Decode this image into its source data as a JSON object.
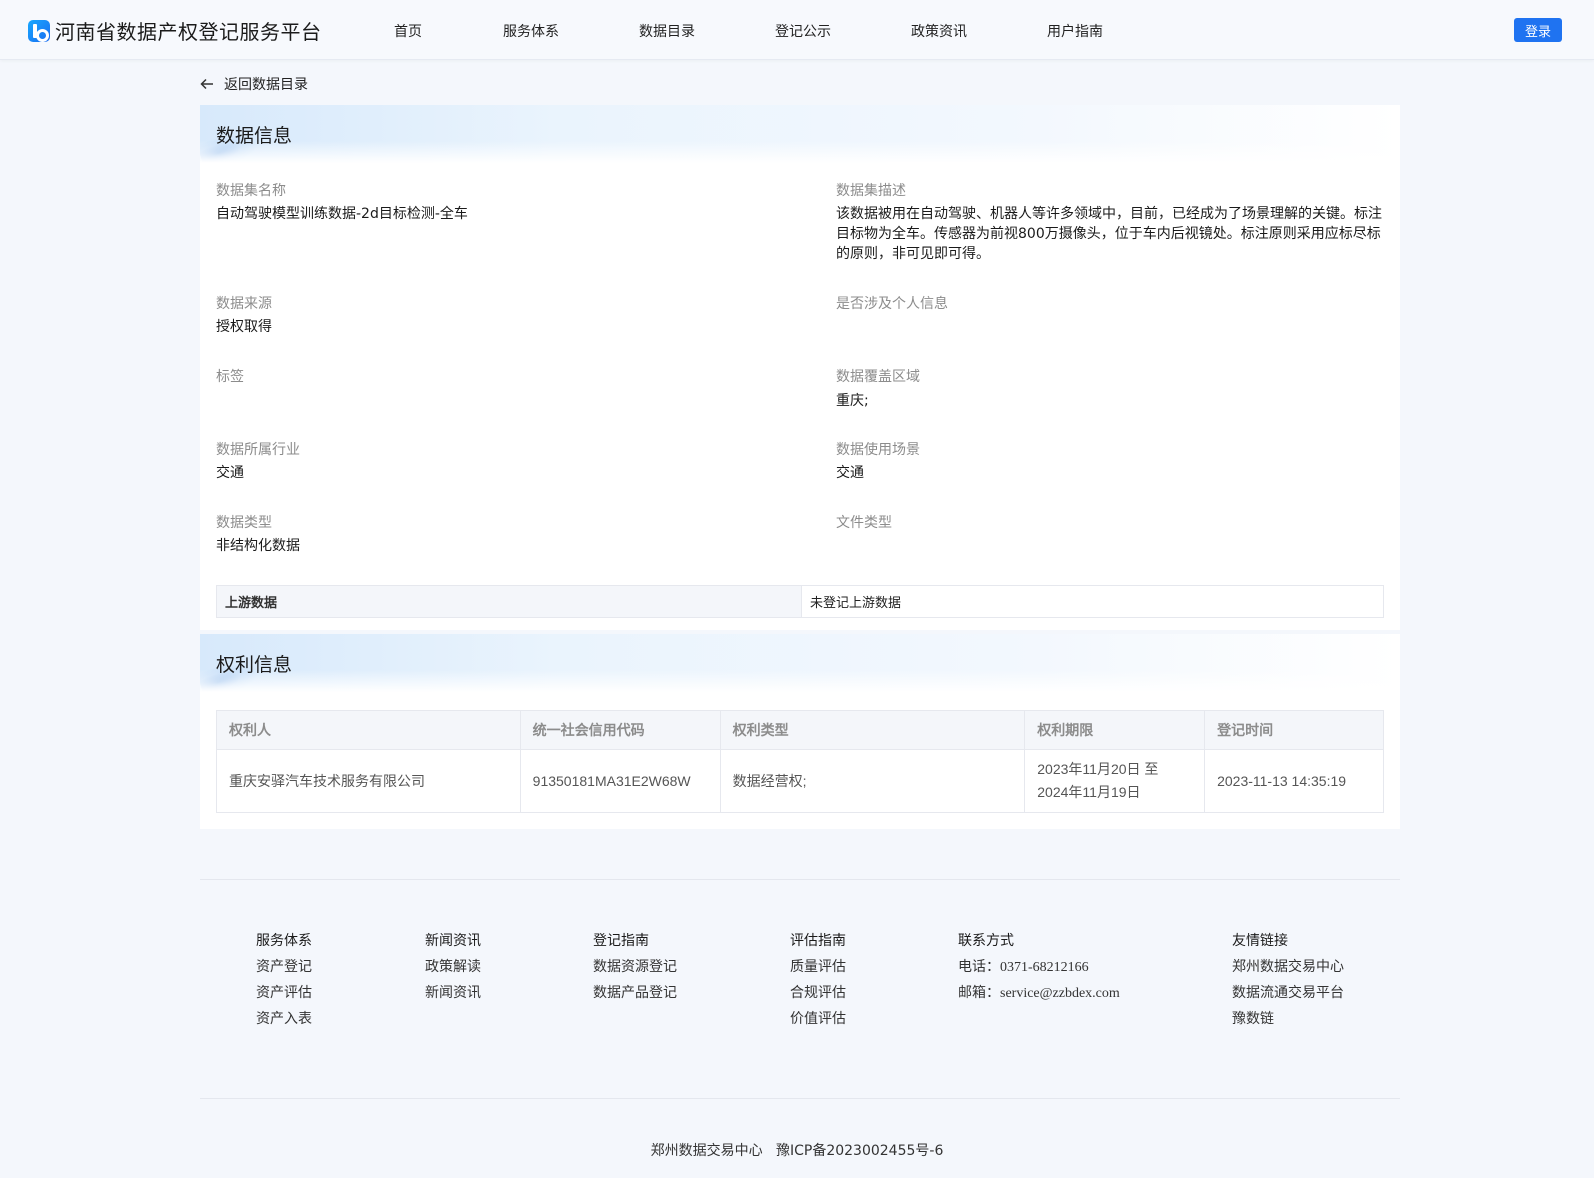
{
  "header": {
    "site_title": "河南省数据产权登记服务平台",
    "nav": [
      "首页",
      "服务体系",
      "数据目录",
      "登记公示",
      "政策资讯",
      "用户指南"
    ],
    "login_label": "登录"
  },
  "back_link": "返回数据目录",
  "data_info": {
    "section_title": "数据信息",
    "fields": {
      "dataset_name": {
        "label": "数据集名称",
        "value": "自动驾驶模型训练数据-2d目标检测-全车"
      },
      "dataset_desc": {
        "label": "数据集描述",
        "value": "该数据被用在自动驾驶、机器人等许多领域中，目前，已经成为了场景理解的关键。标注目标物为全车。传感器为前视800万摄像头，位于车内后视镜处。标注原则采用应标尽标的原则，非可见即可得。"
      },
      "source": {
        "label": "数据来源",
        "value": "授权取得"
      },
      "personal_info": {
        "label": "是否涉及个人信息",
        "value": ""
      },
      "tags": {
        "label": "标签",
        "value": ""
      },
      "coverage": {
        "label": "数据覆盖区域",
        "value": "重庆;"
      },
      "industry": {
        "label": "数据所属行业",
        "value": "交通"
      },
      "scenario": {
        "label": "数据使用场景",
        "value": "交通"
      },
      "data_type": {
        "label": "数据类型",
        "value": "非结构化数据"
      },
      "file_type": {
        "label": "文件类型",
        "value": ""
      }
    },
    "upstream": {
      "label": "上游数据",
      "value": "未登记上游数据"
    }
  },
  "rights_info": {
    "section_title": "权利信息",
    "columns": [
      "权利人",
      "统一社会信用代码",
      "权利类型",
      "权利期限",
      "登记时间"
    ],
    "rows": [
      {
        "holder": "重庆安驿汽车技术服务有限公司",
        "credit_code": "91350181MA31E2W68W",
        "right_type": "数据经营权;",
        "period_line1": "2023年11月20日 至",
        "period_line2": "2024年11月19日",
        "reg_time": "2023-11-13 14:35:19"
      }
    ]
  },
  "footer": {
    "columns": [
      {
        "title": "服务体系",
        "links": [
          "资产登记",
          "资产评估",
          "资产入表"
        ]
      },
      {
        "title": "新闻资讯",
        "links": [
          "政策解读",
          "新闻资讯"
        ]
      },
      {
        "title": "登记指南",
        "links": [
          "数据资源登记",
          "数据产品登记"
        ]
      },
      {
        "title": "评估指南",
        "links": [
          "质量评估",
          "合规评估",
          "价值评估"
        ]
      },
      {
        "title": "联系方式",
        "phone_label": "电话：",
        "phone": "0371-68212166",
        "email_label": "邮箱：",
        "email": "service@zzbdex.com"
      },
      {
        "title": "友情链接",
        "links": [
          "郑州数据交易中心",
          "数据流通交易平台",
          "豫数链"
        ]
      }
    ],
    "copyright": "郑州数据交易中心   豫ICP备2023002455号-6"
  }
}
